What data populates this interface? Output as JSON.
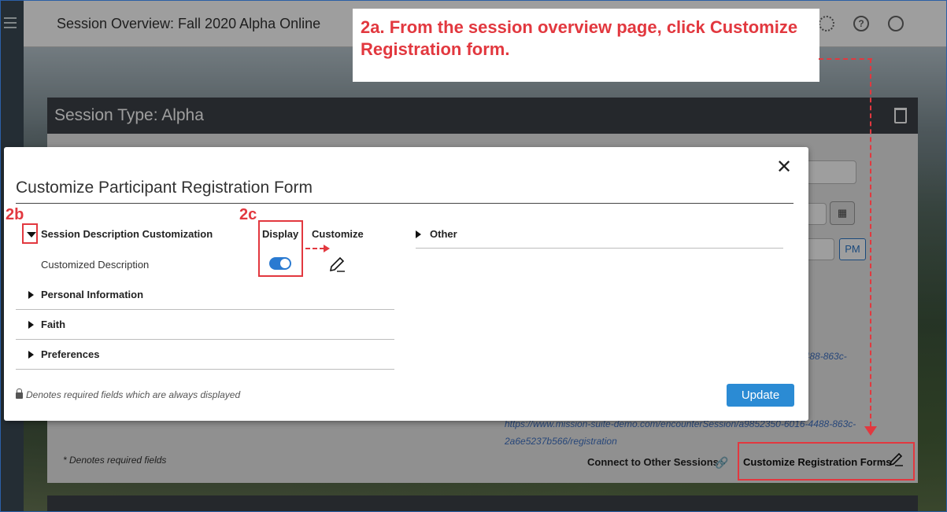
{
  "topbar": {
    "title": "Session Overview: Fall 2020 Alpha Online"
  },
  "session_card": {
    "title": "Session Type: Alpha",
    "required_note": "* Denotes required fields",
    "connect_link": "Connect to Other Sessions",
    "customize_forms_link": "Customize Registration Forms",
    "pm_label": "PM",
    "url_fragment_1": "4488-863c-",
    "registration_url": "https://www.mission-suite-demo.com/encounterSession/a9852350-6016-4488-863c-2a6e5237b566/registration"
  },
  "modal": {
    "title": "Customize Participant Registration Form",
    "close_label": "✕",
    "sections": {
      "session_description": "Session Description Customization",
      "personal": "Personal Information",
      "faith": "Faith",
      "preferences": "Preferences",
      "other": "Other"
    },
    "columns": {
      "display": "Display",
      "customize": "Customize"
    },
    "item": {
      "label": "Customized Description",
      "display_on": true
    },
    "required_note": "Denotes required fields which are always displayed",
    "update_label": "Update"
  },
  "annotations": {
    "step_2a": "2a. From the session overview page, click Customize Registration form.",
    "step_2b": "2b",
    "step_2c": "2c"
  },
  "colors": {
    "accent_blue": "#2b8bd4",
    "annotation_red": "#e2383f"
  }
}
